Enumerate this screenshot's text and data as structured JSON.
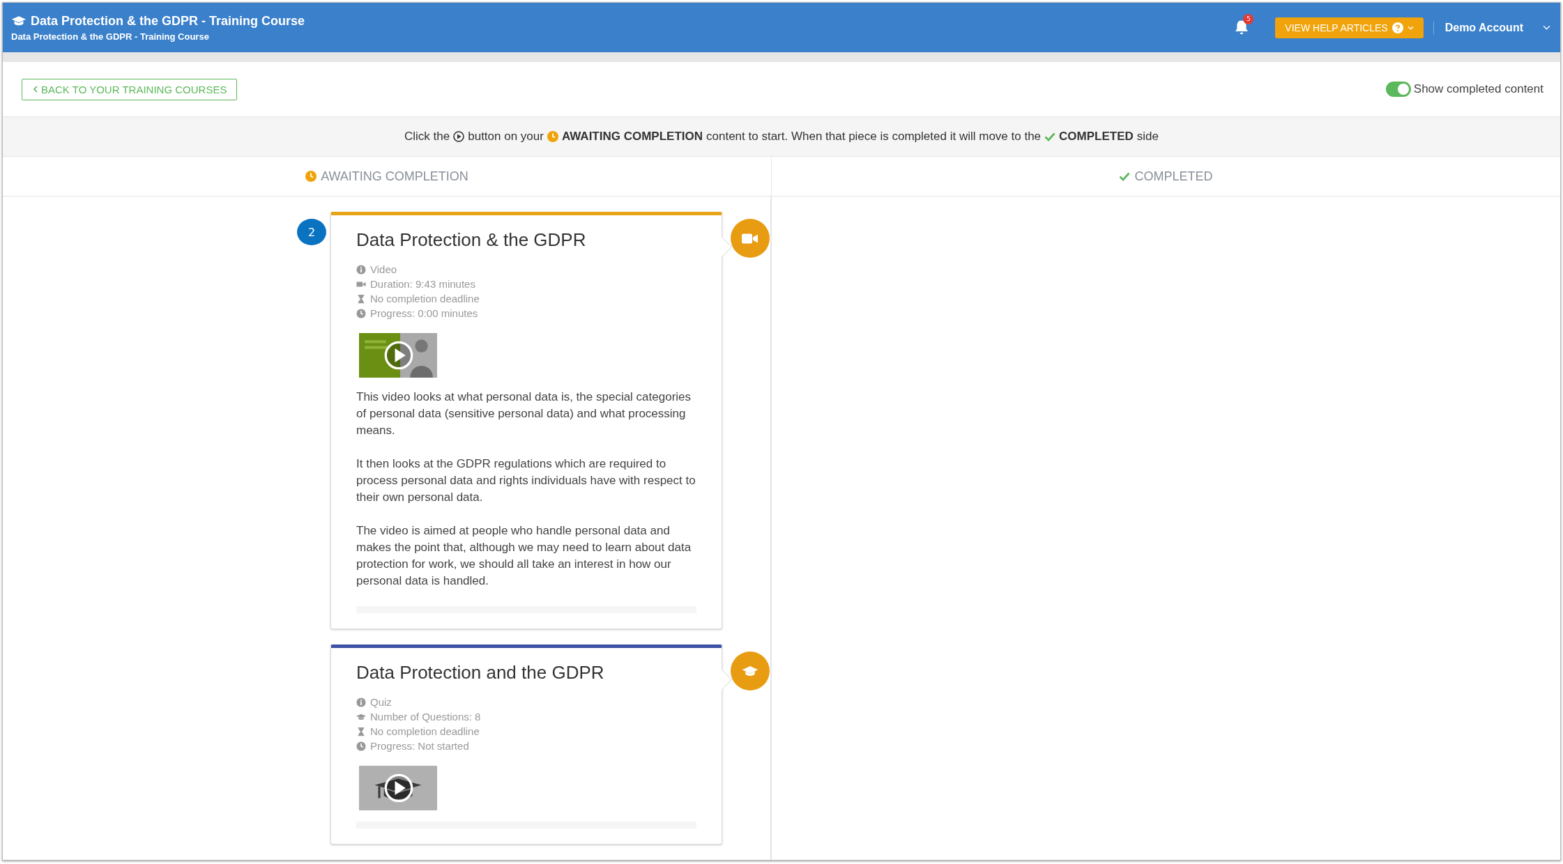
{
  "header": {
    "title": "Data Protection & the GDPR - Training Course",
    "subtitle": "Data Protection & the GDPR - Training Course",
    "notifications": "5",
    "help_button": "VIEW HELP ARTICLES",
    "account": "Demo Account"
  },
  "toolbar": {
    "back_button": "BACK TO YOUR TRAINING COURSES",
    "toggle": {
      "label": "Show completed content",
      "on": true
    }
  },
  "instruction": [
    {
      "kind": "text",
      "text": "Click the"
    },
    {
      "kind": "play"
    },
    {
      "kind": "text",
      "text": "button on your"
    },
    {
      "kind": "pending"
    },
    {
      "kind": "strong",
      "text": "AWAITING COMPLETION"
    },
    {
      "kind": "text",
      "text": "content to start. When that piece is completed it will move to the"
    },
    {
      "kind": "done"
    },
    {
      "kind": "strong",
      "text": "COMPLETED"
    },
    {
      "kind": "text",
      "text": "side"
    }
  ],
  "columns": [
    {
      "kind": "pending",
      "label": "AWAITING COMPLETION"
    },
    {
      "kind": "done",
      "label": "COMPLETED"
    }
  ],
  "cards": [
    {
      "number": "2",
      "kind": "video",
      "color": "#e8a317",
      "title": "Data Protection & the GDPR",
      "meta": [
        {
          "kind": "type",
          "text": "Video"
        },
        {
          "kind": "duration",
          "text": "Duration: 9:43 minutes"
        },
        {
          "kind": "deadline",
          "text": "No completion deadline"
        },
        {
          "kind": "progress",
          "text": "Progress: 0:00 minutes"
        }
      ],
      "paragraphs": [
        "This video looks at what personal data is, the special categories of personal data (sensitive personal data) and what processing means.",
        "It then looks at the GDPR regulations which are required to process personal data and rights individuals have with respect to their own personal data.",
        "The video is aimed at people who handle personal data and makes the point that, although we may need to learn about data protection for work, we should all take an interest in how our personal data is handled."
      ],
      "level": 0
    },
    {
      "kind": "quiz",
      "color": "#3f51a5",
      "title": "Data Protection and the GDPR",
      "meta": [
        {
          "kind": "type",
          "text": "Quiz"
        },
        {
          "kind": "questions",
          "text": "Number of Questions: 8"
        },
        {
          "kind": "deadline",
          "text": "No completion deadline"
        },
        {
          "kind": "progress",
          "text": "Progress: Not started"
        }
      ],
      "level": 0
    }
  ]
}
